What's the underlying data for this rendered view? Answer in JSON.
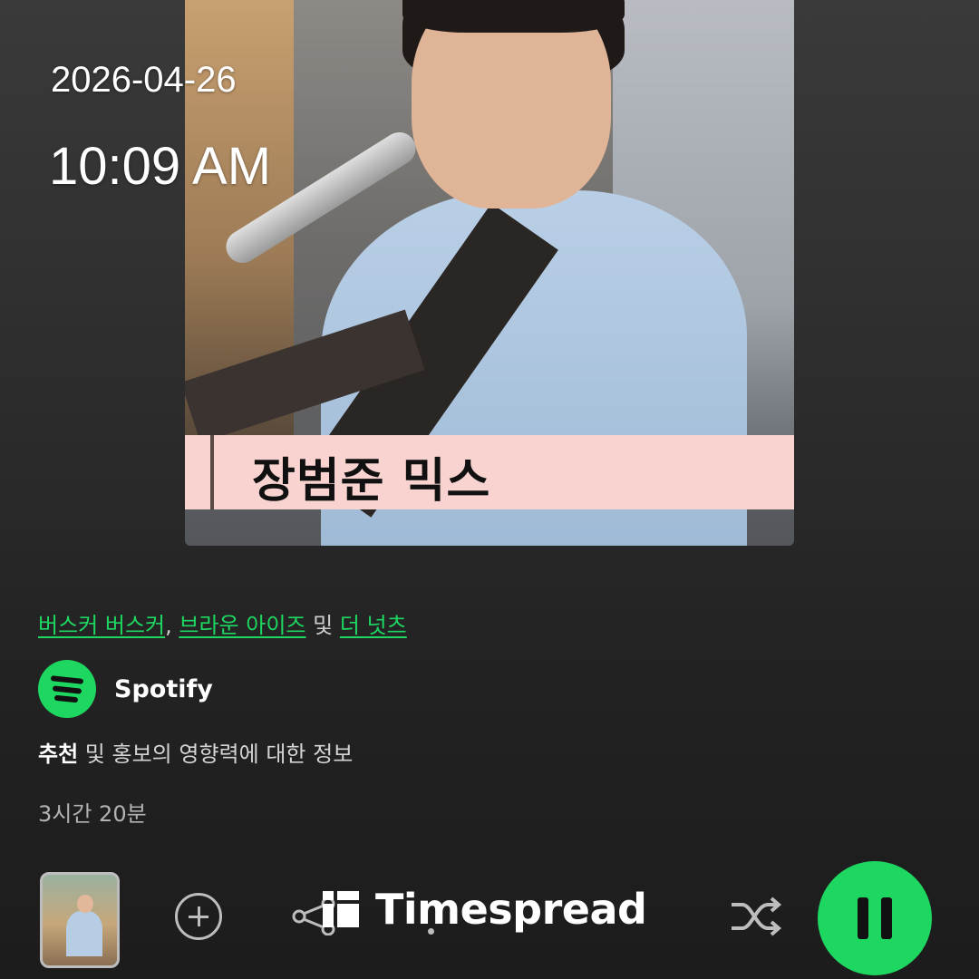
{
  "overlay": {
    "date": "2026-04-26",
    "time": "10:09 AM"
  },
  "playlist": {
    "cover_title": "장범준 믹스",
    "artists": [
      "버스커 버스커",
      "브라운 아이즈",
      "더 넛츠"
    ],
    "separator_comma": ",",
    "separator_and": "및",
    "owner": "Spotify",
    "about_bold": "추천",
    "about_rest": " 및 홍보의 영향력에 대한 정보",
    "duration": "3시간 20분"
  },
  "watermark": {
    "text": "Timespread"
  },
  "colors": {
    "accent": "#1ed760",
    "banner": "#f9d3cf"
  },
  "icons": [
    "add-icon",
    "share-icon",
    "more-icon",
    "shuffle-icon",
    "pause-icon",
    "spotify-logo-icon"
  ]
}
